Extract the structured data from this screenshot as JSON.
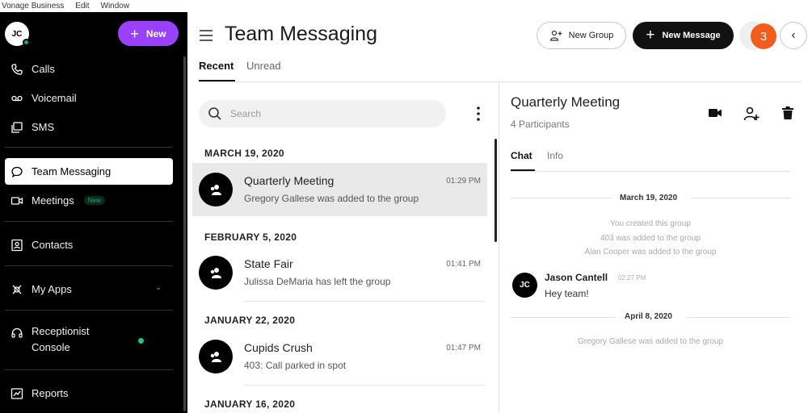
{
  "os_menu": [
    "Vonage Business",
    "Edit",
    "Window"
  ],
  "sidebar": {
    "user_initials": "JC",
    "new_button": "New",
    "items": [
      {
        "label": "Calls",
        "icon": "phone-icon"
      },
      {
        "label": "Voicemail",
        "icon": "voicemail-icon"
      },
      {
        "label": "SMS",
        "icon": "sms-icon"
      },
      {
        "label": "Team Messaging",
        "icon": "chat-bubble-icon",
        "active": true
      },
      {
        "label": "Meetings",
        "icon": "video-icon",
        "badge": "New"
      },
      {
        "label": "Contacts",
        "icon": "contacts-icon"
      },
      {
        "label": "My Apps",
        "icon": "apps-icon"
      },
      {
        "label_line1": "Receptionist",
        "label_line2": "Console",
        "icon": "headset-icon"
      },
      {
        "label": "Reports",
        "icon": "chart-icon"
      }
    ]
  },
  "header": {
    "title": "Team Messaging",
    "new_group_button": "New Group",
    "new_message_button": "New Message",
    "notification_count": "3"
  },
  "tabs": {
    "recent": "Recent",
    "unread": "Unread"
  },
  "search": {
    "placeholder": "Search"
  },
  "conversations": [
    {
      "date_header": "MARCH 19, 2020",
      "name": "Quarterly Meeting",
      "time": "01:29 PM",
      "preview": "Gregory Gallese was added to the group",
      "selected": true
    },
    {
      "date_header": "FEBRUARY 5, 2020",
      "name": "State Fair",
      "time": "01:41 PM",
      "preview": "Julissa DeMaria has left the group"
    },
    {
      "date_header": "JANUARY 22, 2020",
      "name": "Cupids Crush",
      "time": "01:47 PM",
      "preview": "403: Call parked in spot"
    },
    {
      "date_header": "JANUARY 16, 2020"
    }
  ],
  "detail": {
    "title": "Quarterly Meeting",
    "participants": "4 Participants",
    "tabs": {
      "chat": "Chat",
      "info": "Info"
    },
    "day1": "March 19, 2020",
    "system_messages": [
      "You created this group",
      "403 was added to the group",
      "Alan Cooper was added to the group"
    ],
    "message": {
      "initials": "JC",
      "author": "Jason Cantell",
      "time": "02:27 PM",
      "text": "Hey team!"
    },
    "day2": "April 8, 2020",
    "system_message_2": "Gregory Gallese was added to the group"
  },
  "colors": {
    "accent": "#9941ff",
    "notification": "#f25c1d",
    "online": "#1fa86a",
    "sidebar_bg": "#000000"
  }
}
